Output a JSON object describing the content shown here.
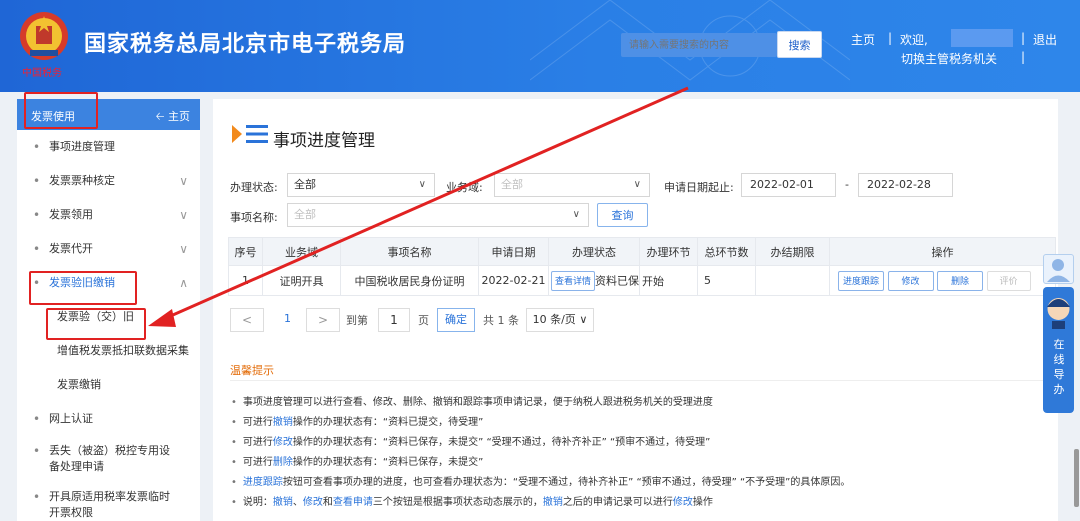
{
  "header": {
    "title": "国家税务总局北京市电子税务局",
    "logo_text": "中国税务",
    "search_placeholder": "请输入需要搜索的内容",
    "search_button": "搜索",
    "home": "主页",
    "welcome": "欢迎,",
    "logout": "退出",
    "switch": "切换主管税务机关",
    "separator": "|"
  },
  "sidebar": {
    "head_label": "发票使用",
    "head_home": "主页",
    "items": [
      {
        "label": "事项进度管理"
      },
      {
        "label": "发票票种核定"
      },
      {
        "label": "发票领用"
      },
      {
        "label": "发票代开"
      },
      {
        "label": "发票验旧缴销"
      },
      {
        "label": "发票验（交）旧"
      },
      {
        "label": "增值税发票抵扣联数据采集"
      },
      {
        "label": "发票缴销"
      },
      {
        "label": "网上认证"
      },
      {
        "label_line1": "丢失（被盗）税控专用设",
        "label_line2": "备处理申请"
      },
      {
        "label_line1": "开具原适用税率发票临时",
        "label_line2": "开票权限"
      }
    ]
  },
  "main": {
    "title": "事项进度管理",
    "filters": {
      "status_label": "办理状态:",
      "status_value": "全部",
      "business_label": "业务域:",
      "business_value": "全部",
      "date_label": "申请日期起止:",
      "date_from": "2022-02-01",
      "date_sep": "-",
      "date_to": "2022-02-28",
      "item_label": "事项名称:",
      "item_value": "全部",
      "query_button": "查询"
    },
    "table": {
      "columns": [
        "序号",
        "业务域",
        "事项名称",
        "申请日期",
        "办理状态",
        "办理环节",
        "总环节数",
        "办结期限",
        "操作"
      ],
      "rows": [
        {
          "index": "1",
          "domain": "证明开具",
          "name": "中国税收居民身份证明",
          "date": "2022-02-21",
          "detail_btn": "查看详情",
          "status": "资料已保",
          "stage": "开始",
          "total": "5",
          "deadline": "",
          "ops": [
            "进度跟踪",
            "修改",
            "删除",
            "评价"
          ]
        }
      ]
    },
    "pager": {
      "prev": "<",
      "page": "1",
      "next": ">",
      "goto_label": "到第",
      "goto_value": "1",
      "page_unit": "页",
      "confirm": "确定",
      "total": "共 1 条",
      "page_size": "10 条/页"
    },
    "tips": {
      "title": "温馨提示",
      "bullet": "•",
      "t1": "事项进度管理可以进行查看、修改、删除、撤销和跟踪事项申请记录，便于纳税人跟进税务机关的受理进度",
      "t2_a": "可进行",
      "t2_b": "撤销",
      "t2_c": "操作的办理状态有：“资料已提交，待受理”",
      "t3_a": "可进行",
      "t3_b": "修改",
      "t3_c": "操作的办理状态有：“资料已保存，未提交”  “受理不通过，待补齐补正”  “预审不通过，待受理”",
      "t4_a": "可进行",
      "t4_b": "删除",
      "t4_c": "操作的办理状态有：“资料已保存，未提交”",
      "t5_a": "进度跟踪",
      "t5_b": "按钮可查看事项办理的进度，也可查看办理状态为：“受理不通过，待补齐补正”  “预审不通过，待受理”  “不予受理”的具体原因。",
      "t6_a": "说明：",
      "t6_b": "撤销",
      "t6_c": "、",
      "t6_d": "修改",
      "t6_e": "和",
      "t6_f": "查看申请",
      "t6_g": "三个按钮是根据事项状态动态展示的，",
      "t6_h": "撤销",
      "t6_i": "之后的申请记录可以进行",
      "t6_j": "修改",
      "t6_k": "操作"
    }
  },
  "float": {
    "guide": "在线导办"
  },
  "colors": {
    "header": "#2a7fe6",
    "accent": "#2a73d9",
    "annotation": "#e12222",
    "tips_title": "#e36c09"
  }
}
